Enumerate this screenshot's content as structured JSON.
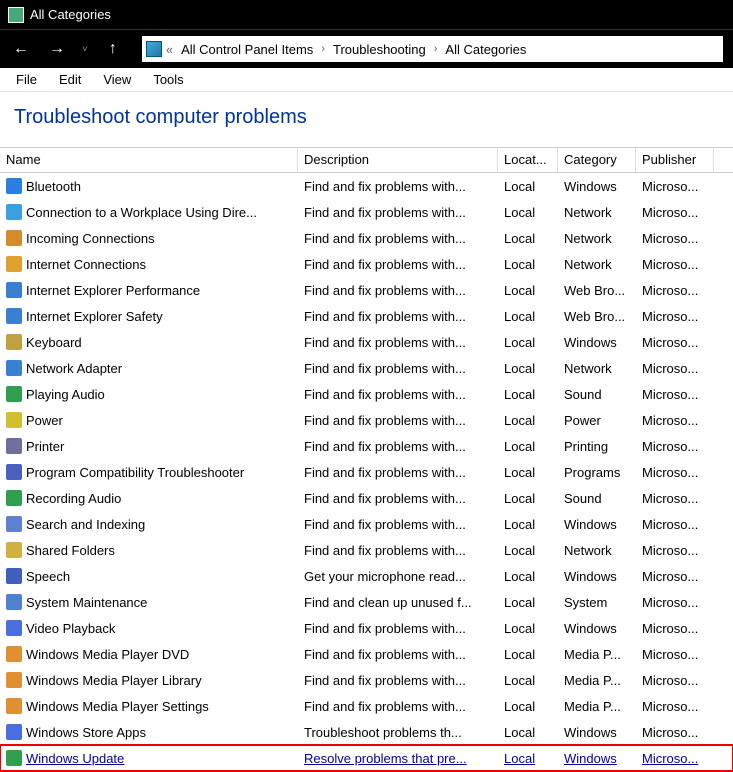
{
  "window": {
    "title": "All Categories"
  },
  "nav": {
    "breadcrumb_prefix": "«",
    "segments": [
      "All Control Panel Items",
      "Troubleshooting",
      "All Categories"
    ]
  },
  "menu": {
    "items": [
      "File",
      "Edit",
      "View",
      "Tools"
    ]
  },
  "heading": "Troubleshoot computer problems",
  "columns": {
    "name": "Name",
    "desc": "Description",
    "loc": "Locat...",
    "cat": "Category",
    "pub": "Publisher"
  },
  "rows": [
    {
      "ico": "bt",
      "name": "Bluetooth",
      "desc": "Find and fix problems with...",
      "loc": "Local",
      "cat": "Windows",
      "pub": "Microso..."
    },
    {
      "ico": "wp",
      "name": "Connection to a Workplace Using Dire...",
      "desc": "Find and fix problems with...",
      "loc": "Local",
      "cat": "Network",
      "pub": "Microso..."
    },
    {
      "ico": "in",
      "name": "Incoming Connections",
      "desc": "Find and fix problems with...",
      "loc": "Local",
      "cat": "Network",
      "pub": "Microso..."
    },
    {
      "ico": "ic",
      "name": "Internet Connections",
      "desc": "Find and fix problems with...",
      "loc": "Local",
      "cat": "Network",
      "pub": "Microso..."
    },
    {
      "ico": "iep",
      "name": "Internet Explorer Performance",
      "desc": "Find and fix problems with...",
      "loc": "Local",
      "cat": "Web Bro...",
      "pub": "Microso..."
    },
    {
      "ico": "ies",
      "name": "Internet Explorer Safety",
      "desc": "Find and fix problems with...",
      "loc": "Local",
      "cat": "Web Bro...",
      "pub": "Microso..."
    },
    {
      "ico": "kb",
      "name": "Keyboard",
      "desc": "Find and fix problems with...",
      "loc": "Local",
      "cat": "Windows",
      "pub": "Microso..."
    },
    {
      "ico": "na",
      "name": "Network Adapter",
      "desc": "Find and fix problems with...",
      "loc": "Local",
      "cat": "Network",
      "pub": "Microso..."
    },
    {
      "ico": "pa",
      "name": "Playing Audio",
      "desc": "Find and fix problems with...",
      "loc": "Local",
      "cat": "Sound",
      "pub": "Microso..."
    },
    {
      "ico": "pw",
      "name": "Power",
      "desc": "Find and fix problems with...",
      "loc": "Local",
      "cat": "Power",
      "pub": "Microso..."
    },
    {
      "ico": "pr",
      "name": "Printer",
      "desc": "Find and fix problems with...",
      "loc": "Local",
      "cat": "Printing",
      "pub": "Microso..."
    },
    {
      "ico": "pc",
      "name": "Program Compatibility Troubleshooter",
      "desc": "Find and fix problems with...",
      "loc": "Local",
      "cat": "Programs",
      "pub": "Microso..."
    },
    {
      "ico": "ra",
      "name": "Recording Audio",
      "desc": "Find and fix problems with...",
      "loc": "Local",
      "cat": "Sound",
      "pub": "Microso..."
    },
    {
      "ico": "si",
      "name": "Search and Indexing",
      "desc": "Find and fix problems with...",
      "loc": "Local",
      "cat": "Windows",
      "pub": "Microso..."
    },
    {
      "ico": "sf",
      "name": "Shared Folders",
      "desc": "Find and fix problems with...",
      "loc": "Local",
      "cat": "Network",
      "pub": "Microso..."
    },
    {
      "ico": "sp",
      "name": "Speech",
      "desc": "Get your microphone read...",
      "loc": "Local",
      "cat": "Windows",
      "pub": "Microso..."
    },
    {
      "ico": "sm",
      "name": "System Maintenance",
      "desc": "Find and clean up unused f...",
      "loc": "Local",
      "cat": "System",
      "pub": "Microso..."
    },
    {
      "ico": "vp",
      "name": "Video Playback",
      "desc": "Find and fix problems with...",
      "loc": "Local",
      "cat": "Windows",
      "pub": "Microso..."
    },
    {
      "ico": "wmd",
      "name": "Windows Media Player DVD",
      "desc": "Find and fix problems with...",
      "loc": "Local",
      "cat": "Media P...",
      "pub": "Microso..."
    },
    {
      "ico": "wml",
      "name": "Windows Media Player Library",
      "desc": "Find and fix problems with...",
      "loc": "Local",
      "cat": "Media P...",
      "pub": "Microso..."
    },
    {
      "ico": "wms",
      "name": "Windows Media Player Settings",
      "desc": "Find and fix problems with...",
      "loc": "Local",
      "cat": "Media P...",
      "pub": "Microso..."
    },
    {
      "ico": "wsa",
      "name": "Windows Store Apps",
      "desc": "Troubleshoot problems th...",
      "loc": "Local",
      "cat": "Windows",
      "pub": "Microso..."
    },
    {
      "ico": "wu",
      "name": "Windows Update",
      "desc": "Resolve problems that pre...",
      "loc": "Local",
      "cat": "Windows",
      "pub": "Microso...",
      "sel": true
    }
  ]
}
